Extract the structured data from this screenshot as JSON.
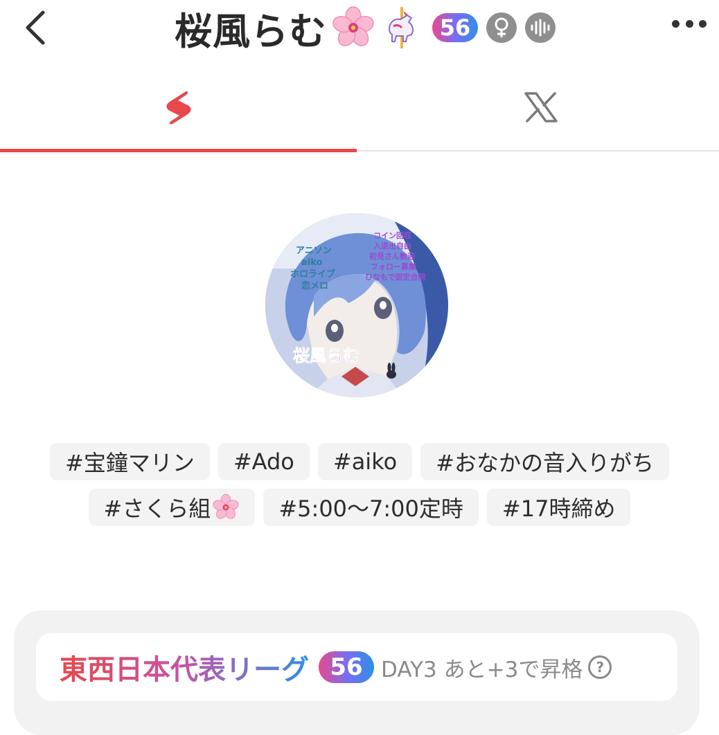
{
  "header": {
    "title": "桜風らむ",
    "emoji_icons": [
      "cherry-blossom-icon",
      "carousel-horse-icon"
    ],
    "level": "56",
    "gender_icon": "female-icon",
    "extra_icon": "voice-wave-icon"
  },
  "tabs": [
    {
      "name": "app",
      "icon": "brand-s-icon",
      "active": true,
      "color": "#e8474b"
    },
    {
      "name": "x",
      "icon": "x-logo-icon",
      "active": false
    }
  ],
  "tags_row1": [
    "#宝鐘マリン",
    "#Ado",
    "#aiko",
    "#おなかの音入りがち"
  ],
  "tags_row2": [
    "#さくら組",
    "#5:00〜7:00定時",
    "#17時締め"
  ],
  "league": {
    "name": "東西日本代表リーグ",
    "level": "56",
    "status": "DAY3 あと+3で昇格"
  },
  "colors": {
    "accent": "#e8474b",
    "badge_gradient": [
      "#e94a8a",
      "#7b6cf0",
      "#2f8fe8"
    ],
    "tag_bg": "#f3f3f3"
  }
}
